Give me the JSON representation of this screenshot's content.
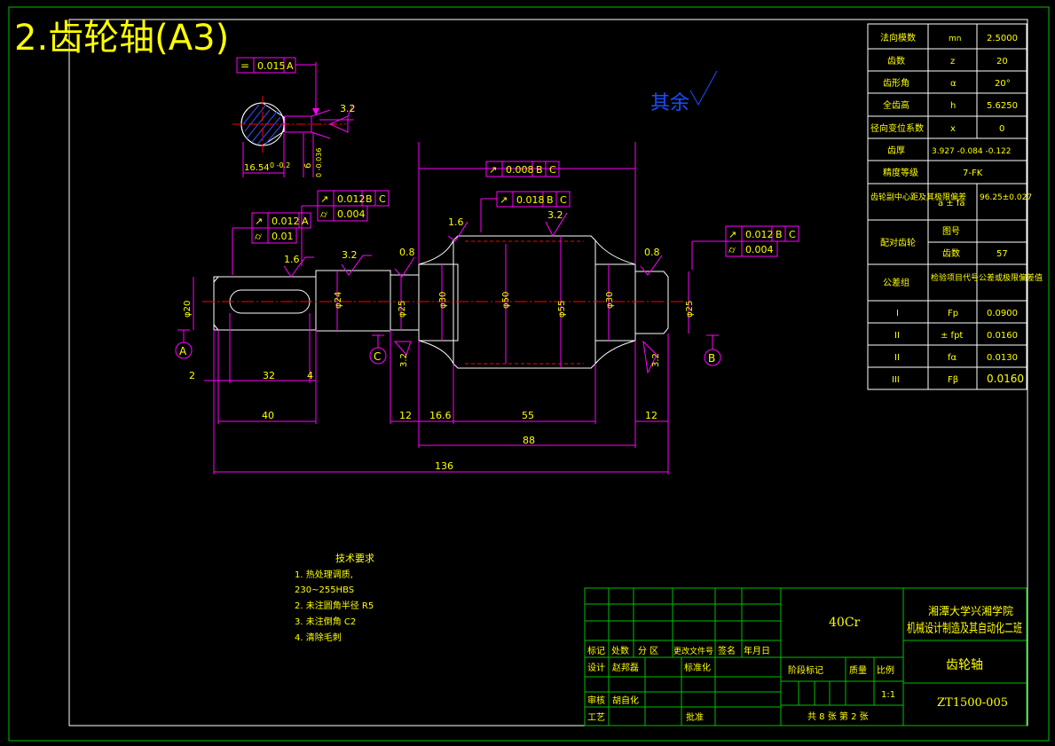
{
  "page_title": "2.齿轮轴(A3)",
  "roughness_note": "其余",
  "colors": {
    "bg": "#000000",
    "frame": "#ffffff",
    "table": "#00ff00",
    "dim": "#ff00ff",
    "text": "#ffff00",
    "part": "#ffffff",
    "center": "#ff0000",
    "title": "#ffff00",
    "note": "#1a4fff"
  },
  "section_view": {
    "tol_sym": "=",
    "tol_val": "0.015",
    "tol_ref": "A",
    "rough": "3.2",
    "dim_width": "16.54",
    "dim_width_tol": "0\n-0.2",
    "dim_key": "6",
    "dim_key_tol": "0\n-0.036"
  },
  "gdt": [
    {
      "sym": "↗",
      "val": "0.008",
      "refs": [
        "B",
        "C"
      ]
    },
    {
      "sym": "↗",
      "val": "0.018",
      "refs": [
        "B",
        "C"
      ]
    },
    {
      "sym": "↗",
      "val": "0.012",
      "refs": [
        "B",
        "C"
      ]
    },
    {
      "sym": "⌭",
      "val": "0.004",
      "refs": []
    },
    {
      "sym": "↗",
      "val": "0.012",
      "refs": [
        "A"
      ]
    },
    {
      "sym": "⌭",
      "val": "0.01",
      "refs": []
    },
    {
      "sym": "↗",
      "val": "0.012",
      "refs": [
        "B",
        "C"
      ]
    },
    {
      "sym": "⌭",
      "val": "0.004",
      "refs": []
    }
  ],
  "roughness": [
    "1.6",
    "3.2",
    "0.8",
    "1.6",
    "3.2",
    "0.8",
    "3.2",
    "3.2"
  ],
  "datums": [
    "A",
    "C",
    "B"
  ],
  "diameters": [
    "φ20",
    "φ24",
    "φ25",
    "φ30",
    "φ50",
    "φ55",
    "φ30",
    "φ25"
  ],
  "dimensions": {
    "d2": "2",
    "d32": "32",
    "d4": "4",
    "d40": "40",
    "d12a": "12",
    "d16_6": "16.6",
    "d55": "55",
    "d12b": "12",
    "d88": "88",
    "d136": "136"
  },
  "tech_req": {
    "title": "技术要求",
    "items": [
      "1. 热处理调质,",
      "230~255HBS",
      "2. 未注圆角半径 R5",
      "3. 未注倒角 C2",
      "4. 清除毛刺"
    ]
  },
  "param_table": [
    [
      "法向模数",
      "mn",
      "2.5000"
    ],
    [
      "齿数",
      "z",
      "20"
    ],
    [
      "齿形角",
      "α",
      "20°"
    ],
    [
      "全齿高",
      "h",
      "5.6250"
    ],
    [
      "径向变位系数",
      "x",
      "0"
    ],
    [
      "齿厚",
      "3.927 -0.084 -0.122",
      ""
    ],
    [
      "精度等级",
      "7-FK",
      ""
    ],
    [
      "齿轮副中心距及其极限偏差",
      "a ± fa",
      "96.25±0.027"
    ],
    [
      "配对齿轮",
      "图号",
      ""
    ],
    [
      "",
      "齿数",
      "57"
    ],
    [
      "公差组",
      "检验项目代号",
      "公差或极限偏差值"
    ],
    [
      "I",
      "Fp",
      "0.0900"
    ],
    [
      "II",
      "± fpt",
      "0.0160"
    ],
    [
      "II",
      "fα",
      "0.0130"
    ],
    [
      "III",
      "Fβ",
      "0.0160"
    ]
  ],
  "title_block": {
    "material": "40Cr",
    "school": "湘潭大学兴湘学院",
    "major": "机械设计制造及其自动化二班",
    "part_name": "齿轮轴",
    "drawing_no": "ZT1500-005",
    "scale": "1:1",
    "sheets": "共 8 张  第 2 张",
    "designer": "赵邦磊",
    "reviewer": "胡自化",
    "labels": {
      "mark": "标记",
      "count": "处数",
      "zone": "分  区",
      "doc": "更改文件号",
      "sign": "签名",
      "date": "年月日",
      "design": "设计",
      "std": "标准化",
      "stage": "阶段标记",
      "mass": "质量",
      "ratio": "比例",
      "review": "审核",
      "craft": "工艺",
      "approve": "批准"
    }
  }
}
